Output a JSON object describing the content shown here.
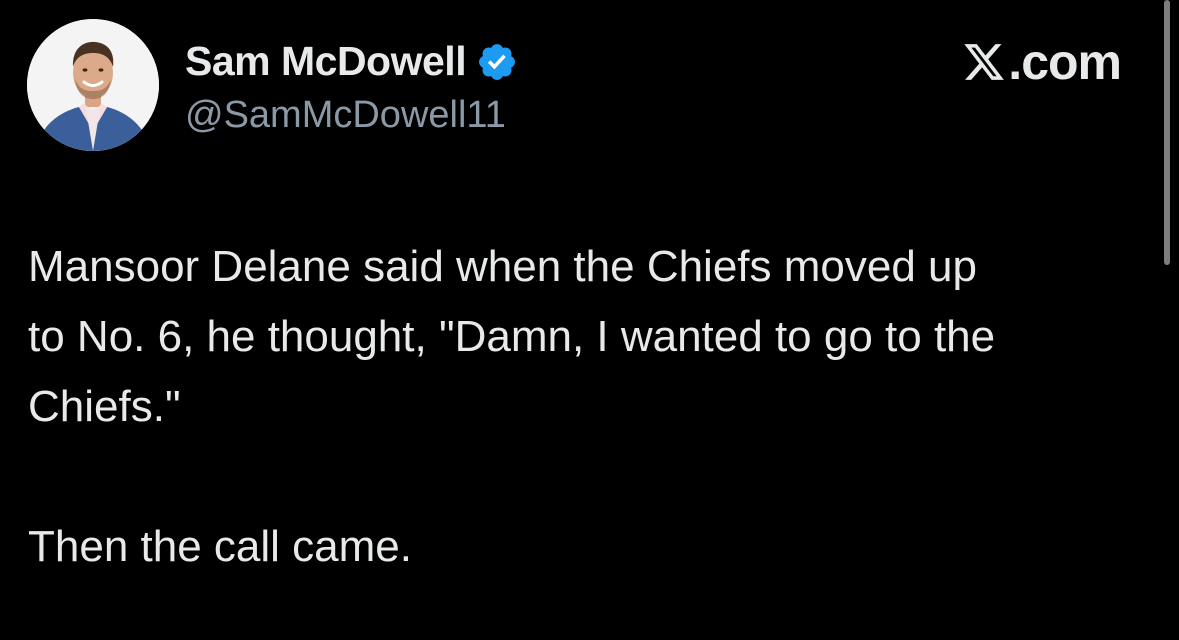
{
  "author": {
    "display_name": "Sam McDowell",
    "handle": "@SamMcDowell11",
    "verified": true,
    "verified_icon": "verified-badge-icon",
    "avatar_icon": "profile-photo"
  },
  "brand": {
    "logo_icon": "x-logo-icon",
    "text": ".com"
  },
  "tweet": {
    "lines": [
      "Mansoor Delane said when the Chiefs moved up",
      "to No. 6, he thought, \"Damn, I wanted to go to the",
      "Chiefs.\"",
      "Then the call came."
    ]
  },
  "colors": {
    "background": "#000000",
    "text": "#e7e9ea",
    "secondary_text": "#8b98a5",
    "verified_blue": "#1d9bf0"
  }
}
